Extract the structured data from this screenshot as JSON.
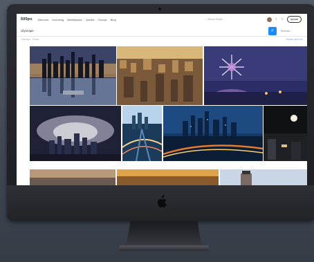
{
  "site": {
    "logo": "500px",
    "nav": [
      "Discover",
      "Licensing",
      "Marketplace",
      "Quests",
      "Groups",
      "Blog"
    ],
    "search_placeholder": "Search 500px",
    "upload_label": "Upload"
  },
  "search": {
    "query": "cityscape",
    "sort_label": "Relevant",
    "results_label": "Cityscape · Photos",
    "related_label": "Related searches"
  },
  "device": {
    "brand_icon": "apple-logo-icon"
  },
  "photos": [
    {
      "name": "photo-skyline-reflection",
      "colors": [
        "#2b2f4a",
        "#e0a85a",
        "#8da4c8"
      ]
    },
    {
      "name": "photo-dense-city-aerial",
      "colors": [
        "#d9b77a",
        "#7a5a3a",
        "#3a2a20"
      ]
    },
    {
      "name": "photo-fireworks-night",
      "colors": [
        "#2a2d66",
        "#c28bd6",
        "#f2e6ff"
      ]
    },
    {
      "name": "photo-hazy-skyline",
      "colors": [
        "#1f2236",
        "#5a5a8a",
        "#d1d2e4"
      ]
    },
    {
      "name": "photo-highway-interchange",
      "colors": [
        "#1b3b5a",
        "#b7d4ec",
        "#5a8cb8"
      ]
    },
    {
      "name": "photo-night-city-lights",
      "colors": [
        "#163a66",
        "#5da8e8",
        "#e87a2a"
      ]
    },
    {
      "name": "photo-moon-street",
      "colors": [
        "#0f1114",
        "#3a3a42",
        "#d8c28a"
      ]
    },
    {
      "name": "photo-bottom-left",
      "colors": [
        "#b89a7a",
        "#6a5a52",
        "#3a3432"
      ]
    },
    {
      "name": "photo-bottom-center",
      "colors": [
        "#e0a24a",
        "#8a5a2a",
        "#3a2a1a"
      ]
    },
    {
      "name": "photo-bottom-right",
      "colors": [
        "#c8d6e6",
        "#7a6a62",
        "#3a3232"
      ]
    }
  ]
}
